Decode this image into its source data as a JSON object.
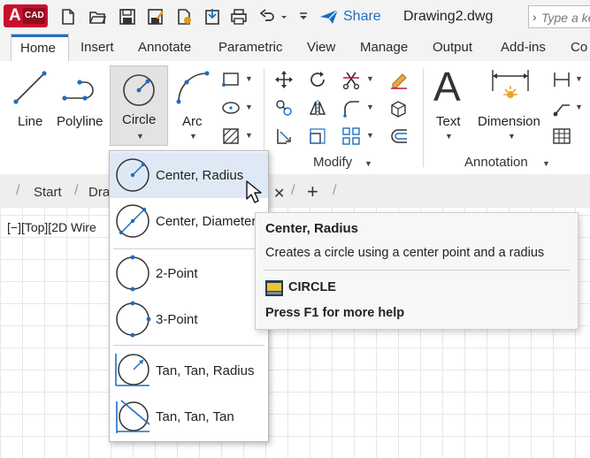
{
  "app": {
    "logo_letter": "A",
    "logo_text": "CAD",
    "share_label": "Share",
    "file_name": "Drawing2.dwg",
    "search_placeholder": "Type a key"
  },
  "ribbon_tabs": [
    "Home",
    "Insert",
    "Annotate",
    "Parametric",
    "View",
    "Manage",
    "Output",
    "Add-ins",
    "Co"
  ],
  "ribbon": {
    "line_label": "Line",
    "polyline_label": "Polyline",
    "circle_label": "Circle",
    "arc_label": "Arc",
    "text_label": "Text",
    "dimension_label": "Dimension",
    "modify_title": "Modify",
    "annotation_title": "Annotation"
  },
  "file_tabs": {
    "start": "Start",
    "drawing": "Dra",
    "close": "✕",
    "add": "+"
  },
  "viewport_label": "[−][Top][2D Wire",
  "circle_menu": {
    "center_radius": "Center, Radius",
    "center_diameter": "Center, Diameter",
    "two_point": "2-Point",
    "three_point": "3-Point",
    "tan_tan_radius": "Tan, Tan, Radius",
    "tan_tan_tan": "Tan, Tan, Tan"
  },
  "tooltip": {
    "title": "Center, Radius",
    "description": "Creates a circle using a center point and a radius",
    "command": "CIRCLE",
    "help": "Press F1 for more help"
  },
  "colors": {
    "accent": "#1d6ec2",
    "logo_red": "#c8102e",
    "highlight": "#dfe9f6"
  }
}
